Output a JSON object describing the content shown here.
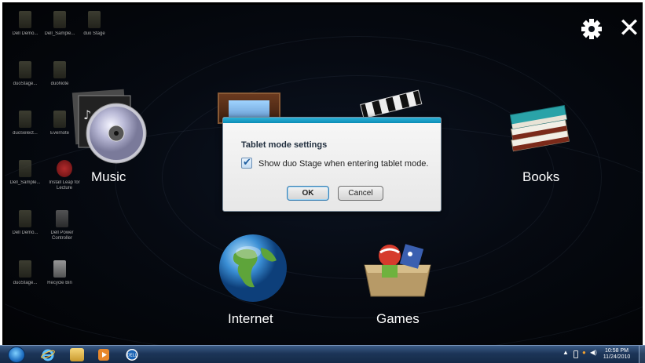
{
  "desktop_icons": [
    {
      "label": "Dell Demo..."
    },
    {
      "label": "Dell_Sample..."
    },
    {
      "label": "duo Stage"
    },
    {
      "label": "duoStage..."
    },
    {
      "label": "duoNote"
    },
    {
      "label": "duoSelect..."
    },
    {
      "label": "Evernote"
    },
    {
      "label": "Dell_Sample..."
    },
    {
      "label": "Install Leap for Lecture"
    },
    {
      "label": "Dell Demo..."
    },
    {
      "label": "Dell Power Controller"
    },
    {
      "label": "duoStage..."
    },
    {
      "label": "Recycle Bin"
    }
  ],
  "stage": {
    "tiles": {
      "music": "Music",
      "books": "Books",
      "internet": "Internet",
      "games": "Games"
    },
    "icons": {
      "settings": "gear-icon",
      "close": "close-icon"
    }
  },
  "dialog": {
    "title": "Tablet mode settings",
    "checkbox_label": "Show duo Stage when entering tablet mode.",
    "checkbox_checked": true,
    "ok_label": "OK",
    "cancel_label": "Cancel"
  },
  "taskbar": {
    "items": [
      "start",
      "internet-explorer",
      "file-explorer",
      "media-player",
      "dell"
    ],
    "tray": {
      "time": "10:58 PM",
      "date": "11/24/2010"
    }
  },
  "colors": {
    "dialog_accent": "#0b8bb5",
    "taskbar": "#1c3558"
  }
}
